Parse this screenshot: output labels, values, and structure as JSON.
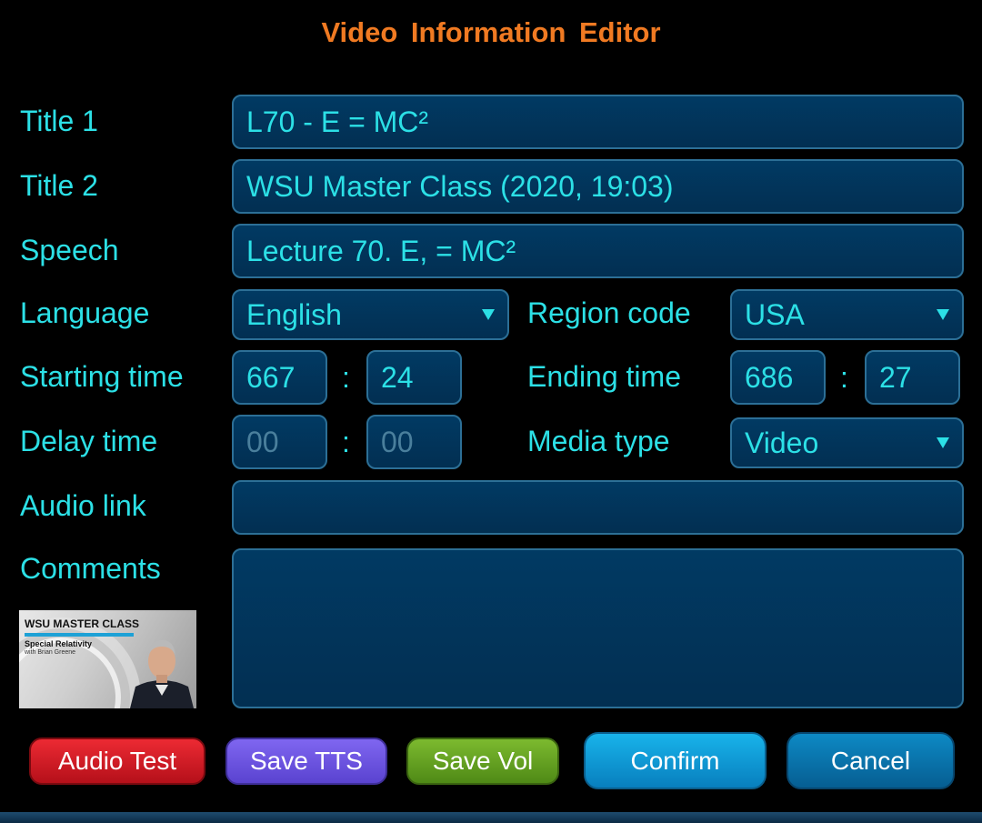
{
  "header": {
    "title": "Video  Information  Editor"
  },
  "labels": {
    "title1": "Title 1",
    "title2": "Title 2",
    "speech": "Speech",
    "language": "Language",
    "region_code": "Region code",
    "starting_time": "Starting time",
    "ending_time": "Ending time",
    "delay_time": "Delay time",
    "media_type": "Media type",
    "audio_link": "Audio link",
    "comments": "Comments"
  },
  "fields": {
    "title1": "L70 - E = MC²",
    "title2": "WSU Master Class (2020, 19:03)",
    "speech": "Lecture 70. E, = MC²",
    "language": "English",
    "region_code": "USA",
    "start_min": "667",
    "start_sec": "24",
    "end_min": "686",
    "end_sec": "27",
    "delay_min": "00",
    "delay_sec": "00",
    "media_type": "Video",
    "audio_link": "",
    "comments": "",
    "time_separator": ":"
  },
  "thumbnail": {
    "brand": "WSU MASTER CLASS",
    "course": "Special Relativity",
    "instructor": "with Brian Greene"
  },
  "buttons": {
    "audio_test": "Audio Test",
    "save_tts": "Save TTS",
    "save_vol": "Save Vol",
    "confirm": "Confirm",
    "cancel": "Cancel"
  },
  "colors": {
    "title": "#f07a22",
    "label": "#2ce0e6",
    "field_bg": "#013a63",
    "field_border": "#2c6f96"
  }
}
